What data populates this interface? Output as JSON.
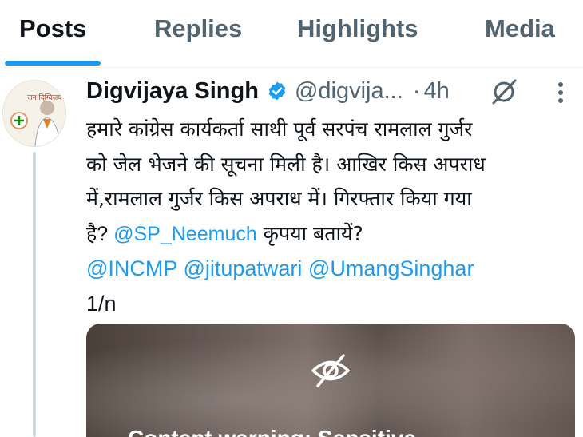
{
  "tabs": [
    {
      "label": "Posts",
      "active": true
    },
    {
      "label": "Replies",
      "active": false
    },
    {
      "label": "Highlights",
      "active": false
    },
    {
      "label": "Media",
      "active": false
    }
  ],
  "colors": {
    "accent": "#1d9bf0",
    "text": "#0f1419",
    "muted": "#536471",
    "divider": "#eff3f4"
  },
  "post": {
    "author_name": "Digvijaya Singh",
    "verified": true,
    "handle": "@digvija...",
    "separator": "·",
    "time": "4h",
    "avatar_icon": "profile-photo-avatar",
    "avatar_text": "जन दिग्विजय",
    "text_lines": [
      {
        "before": "हमारे कांग्रेस कार्यकर्ता साथी पूर्व सरपंच रामलाल गुर्जर",
        "mention": "",
        "after": ""
      },
      {
        "before": "को जेल भेजने की सूचना  मिली है। आखिर किस अपराध",
        "mention": "",
        "after": ""
      },
      {
        "before": "में,रामलाल गुर्जर किस अपराध में। गिरफ्तार किया गया",
        "mention": "",
        "after": ""
      },
      {
        "before": "है? ",
        "mention": "@SP_Neemuch",
        "after": " कृपया बतायें?"
      }
    ],
    "mentions": [
      "@INCMP",
      "@jitupatwari",
      "@UmangSinghar"
    ],
    "thread_count": "1/n",
    "media": {
      "hidden_icon": "eye-slash-icon",
      "warning_text": "Content warning: Sensitive"
    }
  }
}
